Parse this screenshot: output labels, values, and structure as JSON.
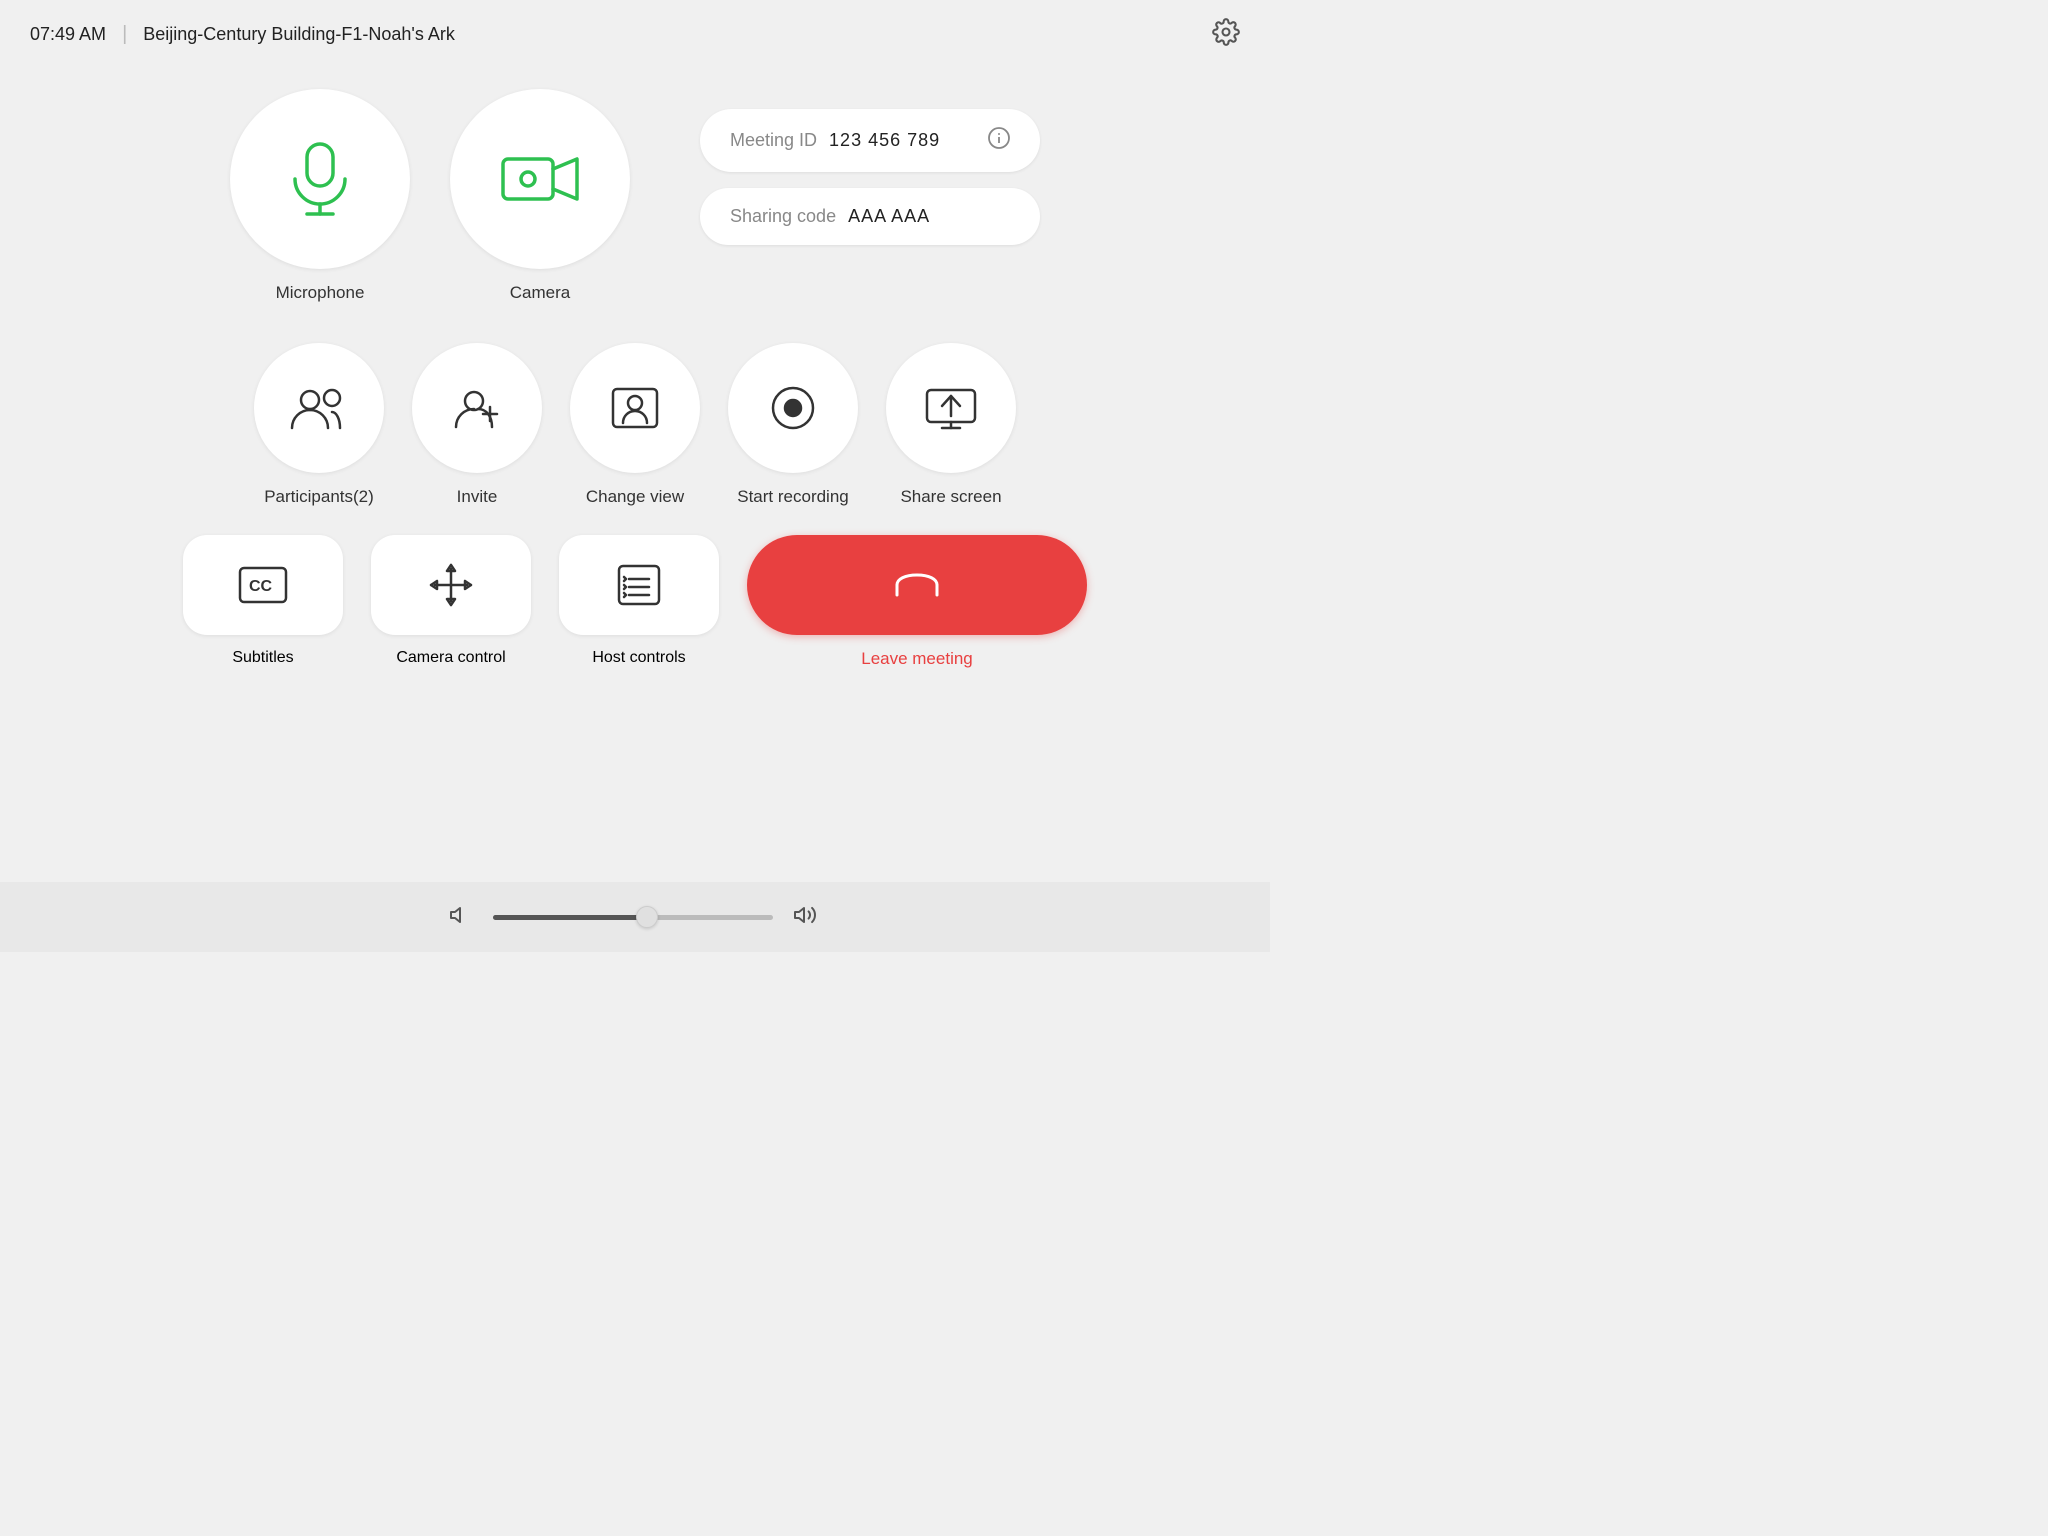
{
  "header": {
    "time": "07:49 AM",
    "location": "Beijing-Century Building-F1-Noah's Ark"
  },
  "meeting": {
    "id_label": "Meeting ID",
    "id_value": "123 456 789",
    "code_label": "Sharing code",
    "code_value": "AAA AAA"
  },
  "controls": {
    "microphone_label": "Microphone",
    "camera_label": "Camera",
    "participants_label": "Participants(2)",
    "invite_label": "Invite",
    "change_view_label": "Change view",
    "start_recording_label": "Start recording",
    "share_screen_label": "Share screen",
    "subtitles_label": "Subtitles",
    "camera_control_label": "Camera control",
    "host_controls_label": "Host controls",
    "leave_label": "Leave meeting"
  },
  "volume": {
    "fill_percent": 55
  }
}
